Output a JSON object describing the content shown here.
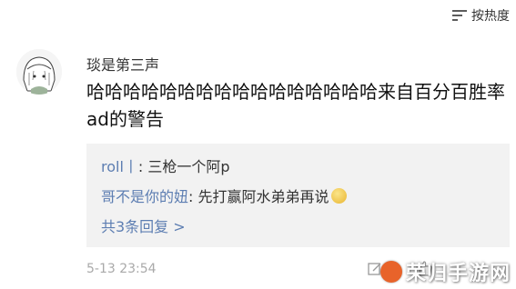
{
  "sort": {
    "label": "按热度",
    "icon": "sort-icon"
  },
  "comment": {
    "username": "琰是第三声",
    "text": "哈哈哈哈哈哈哈哈哈哈哈哈哈哈哈哈来自百分百胜率ad的警告",
    "timestamp": "5-13 23:54"
  },
  "replies": [
    {
      "name": "roll丨",
      "text": ": 三枪一个阿p"
    },
    {
      "name": "哥不是你的妞",
      "text": ": 先打赢阿水弟弟再说",
      "emoji": "thinking-emoji"
    }
  ],
  "more_replies": "共3条回复 >",
  "watermark": {
    "text": "荣归手游网"
  },
  "colors": {
    "link": "#5d7eb2",
    "reply_bg": "#f2f2f2",
    "muted": "#a9a9a9"
  }
}
